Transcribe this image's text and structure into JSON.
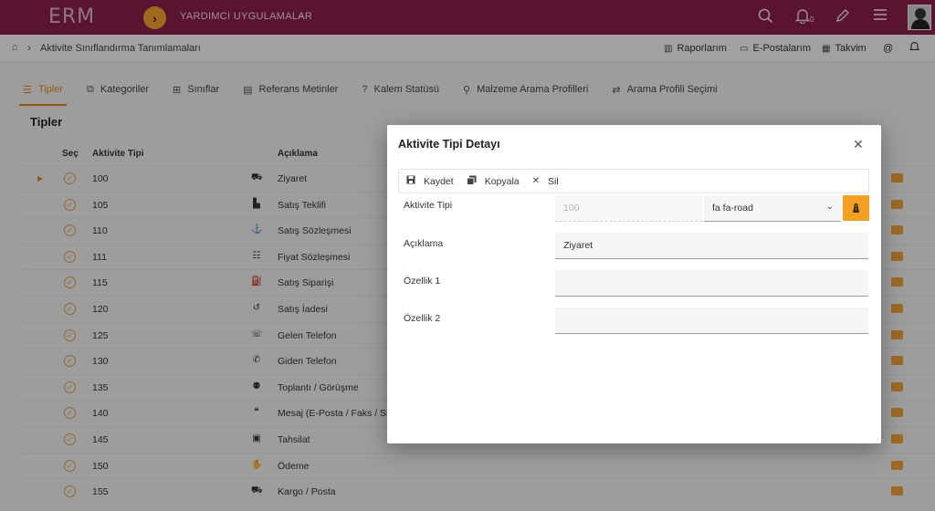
{
  "header": {
    "logo": "ERM",
    "apps_arrow": "›",
    "apps_label": "YARDIMCI UYGULAMALAR",
    "notification_count": "0"
  },
  "breadcrumb": {
    "page": "Aktivite Sınıflandırma Tanımlamaları"
  },
  "quick_links": {
    "reports": "Raporlarım",
    "emails": "E-Postalarım",
    "calendar": "Takvim"
  },
  "tabs": [
    {
      "label": "Tipler"
    },
    {
      "label": "Kategoriler"
    },
    {
      "label": "Sınıflar"
    },
    {
      "label": "Referans Metinler"
    },
    {
      "label": "Kalem Statüsü"
    },
    {
      "label": "Malzeme Arama Profilleri"
    },
    {
      "label": "Arama Profili Seçimi"
    }
  ],
  "section": {
    "title": "Tipler"
  },
  "table": {
    "headers": {
      "select": "Seç",
      "code": "Aktivite Tipi",
      "desc": "Açıklama"
    },
    "rows": [
      {
        "code": "100",
        "desc": "Ziyaret",
        "icon": "road-icon"
      },
      {
        "code": "105",
        "desc": "Satış Teklifi",
        "icon": "file-icon"
      },
      {
        "code": "110",
        "desc": "Satış Sözleşmesi",
        "icon": "anchor-icon"
      },
      {
        "code": "111",
        "desc": "Fiyat Sözleşmesi",
        "icon": "list-icon"
      },
      {
        "code": "115",
        "desc": "Satış Siparişi",
        "icon": "basket-icon"
      },
      {
        "code": "120",
        "desc": "Satış İadesi",
        "icon": "undo-icon"
      },
      {
        "code": "125",
        "desc": "Gelen Telefon",
        "icon": "phone-volume-icon"
      },
      {
        "code": "130",
        "desc": "Giden Telefon",
        "icon": "phone-icon"
      },
      {
        "code": "135",
        "desc": "Toplantı / Görüşme",
        "icon": "users-icon"
      },
      {
        "code": "140",
        "desc": "Mesaj (E-Posta / Faks / SMS)",
        "icon": "comments-icon"
      },
      {
        "code": "145",
        "desc": "Tahsilat",
        "icon": "money-icon"
      },
      {
        "code": "150",
        "desc": "Ödeme",
        "icon": "hand-icon"
      },
      {
        "code": "155",
        "desc": "Kargo / Posta",
        "icon": "truck-icon"
      }
    ]
  },
  "modal": {
    "title": "Aktivite Tipi Detayı",
    "toolbar": {
      "save": "Kaydet",
      "copy": "Kopyala",
      "delete": "Sil"
    },
    "fields": {
      "type_label": "Aktivite Tipi",
      "type_value": "100",
      "icon_value": "fa fa-road",
      "desc_label": "Açıklama",
      "desc_value": "Ziyaret",
      "prop1_label": "Özellik 1",
      "prop1_value": "",
      "prop2_label": "Özellik 2",
      "prop2_value": ""
    }
  },
  "colors": {
    "brand": "#8c1e4d",
    "accent": "#e08a16"
  }
}
